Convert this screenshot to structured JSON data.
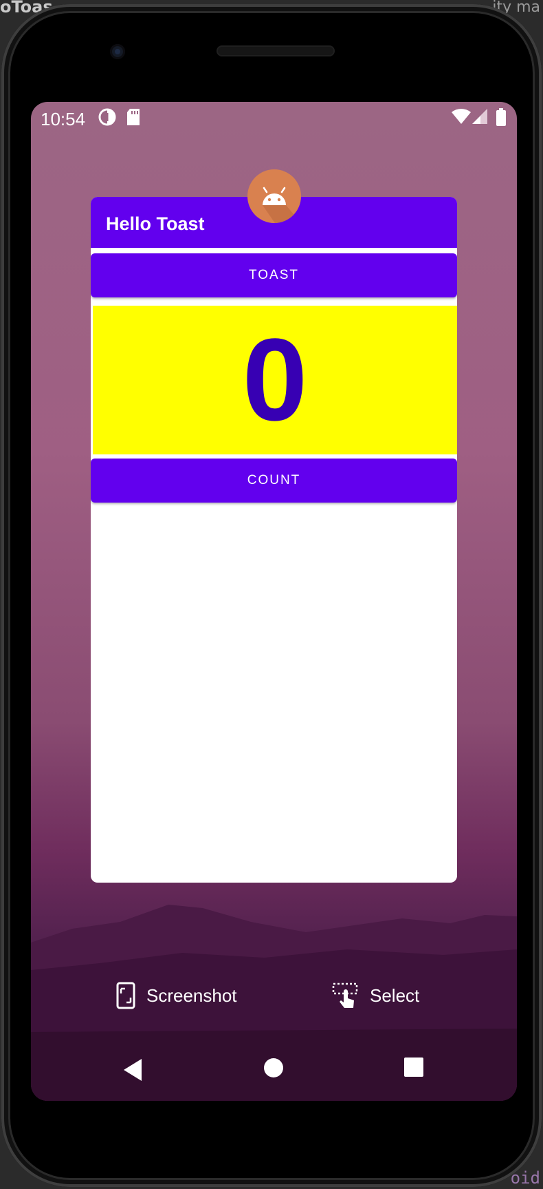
{
  "ide": {
    "title_fragment": "oToas",
    "top_right_fragment": "ity ma",
    "code_fragment": "oid"
  },
  "status_bar": {
    "time": "10:54",
    "icons": [
      "data-saver-icon",
      "sd-card-icon",
      "wifi-icon",
      "cell-signal-icon",
      "battery-icon"
    ]
  },
  "app": {
    "title": "Hello Toast",
    "toast_button": "TOAST",
    "count_value": "0",
    "count_button": "COUNT",
    "colors": {
      "primary": "#6200ee",
      "count_bg": "#ffff00",
      "count_text": "#3700b3",
      "icon_bg": "#d9814f"
    }
  },
  "overview": {
    "screenshot_label": "Screenshot",
    "select_label": "Select"
  },
  "nav": {
    "buttons": [
      "back-icon",
      "home-icon",
      "recents-icon"
    ]
  }
}
